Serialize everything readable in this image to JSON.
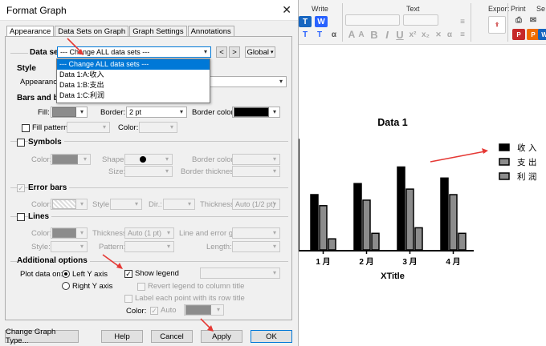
{
  "dialog": {
    "title": "Format Graph",
    "tabs": [
      "Appearance",
      "Data Sets on Graph",
      "Graph Settings",
      "Annotations"
    ],
    "data_set_label": "Data set:",
    "data_set_value": "--- Change ALL data sets ---",
    "prev_label": "<",
    "next_label": ">",
    "global_label": "Global",
    "dataset_options": [
      "--- Change ALL data sets ---",
      "Data 1:A:收入",
      "Data 1:B:支出",
      "Data 1:C:利润"
    ],
    "style_heading": "Style",
    "appearance_label": "Appearance:",
    "bars_heading": "Bars and box",
    "fill_label": "Fill:",
    "border_label": "Border:",
    "border_value": "2 pt",
    "border_color_label": "Border color:",
    "fill_pattern_label": "Fill pattern",
    "color_label": "Color:",
    "symbols_heading": "Symbols",
    "sym_color_label": "Color:",
    "shape_label": "Shape:",
    "size_label": "Size:",
    "sym_border_color_label": "Border color:",
    "border_thickness_label": "Border thickness:",
    "error_bars_heading": "Error bars",
    "eb_color_label": "Color:",
    "eb_style_label": "Style:",
    "dir_label": "Dir.:",
    "thickness_label": "Thickness:",
    "thickness_value": "Auto (1/2 pt)",
    "lines_heading": "Lines",
    "ln_color_label": "Color:",
    "ln_thickness_label": "Thickness:",
    "ln_thickness_value": "Auto (1 pt)",
    "line_error_label": "Line and error go:",
    "ln_style_label": "Style:",
    "pattern_label": "Pattern:",
    "length_label": "Length:",
    "additional_heading": "Additional options",
    "plot_on_label": "Plot data on:",
    "left_axis_label": "Left Y axis",
    "right_axis_label": "Right  Y axis",
    "show_legend_label": "Show legend",
    "revert_legend_label": "Revert legend to column title",
    "label_each_label": "Label each point with its row title",
    "addl_color_label": "Color:",
    "auto_label": "Auto",
    "buttons": {
      "change_type": "Change Graph Type...",
      "help": "Help",
      "cancel": "Cancel",
      "apply": "Apply",
      "ok": "OK"
    }
  },
  "ribbon": {
    "write_label": "Write",
    "text_label": "Text",
    "export_label": "Export",
    "print_label": "Print",
    "s_label": "Se"
  },
  "chart_data": {
    "type": "bar",
    "title": "Data 1",
    "xlabel": "XTitle",
    "ylabel": "",
    "categories": [
      "1 月",
      "2 月",
      "3 月",
      "4 月"
    ],
    "series": [
      {
        "name": "收 入",
        "values": [
          20,
          24,
          30,
          26
        ]
      },
      {
        "name": "支 出",
        "values": [
          16,
          18,
          22,
          20
        ]
      },
      {
        "name": "利 润",
        "values": [
          4,
          6,
          8,
          6
        ]
      }
    ],
    "ylim": [
      0,
      40
    ],
    "colors": [
      "#000000",
      "#8c8c8c",
      "#8c8c8c"
    ],
    "legend_position": "right"
  }
}
